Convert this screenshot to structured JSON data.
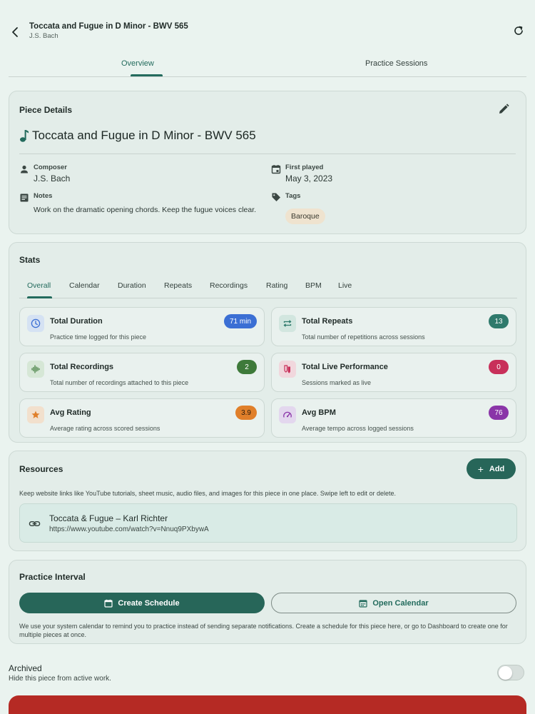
{
  "header": {
    "title": "Toccata and Fugue in D Minor - BWV 565",
    "subtitle": "J.S. Bach"
  },
  "tabs": [
    {
      "label": "Overview",
      "active": true
    },
    {
      "label": "Practice Sessions",
      "active": false
    }
  ],
  "piece_details": {
    "title": "Piece Details",
    "piece_name": "Toccata and Fugue in D Minor - BWV 565",
    "composer_label": "Composer",
    "composer": "J.S. Bach",
    "first_played_label": "First played",
    "first_played": "May 3, 2023",
    "notes_label": "Notes",
    "notes": "Work on the dramatic opening chords. Keep the fugue voices clear.",
    "tags_label": "Tags",
    "tags": [
      "Baroque"
    ]
  },
  "stats": {
    "title": "Stats",
    "tabs": [
      "Overall",
      "Calendar",
      "Duration",
      "Repeats",
      "Recordings",
      "Rating",
      "BPM",
      "Live"
    ],
    "active_tab": "Overall",
    "cards": [
      {
        "title": "Total Duration",
        "description": "Practice time logged for this piece",
        "badge": "71 min",
        "badge_color": "#3b6fd4",
        "icon": "clock-icon",
        "icon_bg": "#d5e2f3",
        "icon_color": "#3b6fd4"
      },
      {
        "title": "Total Repeats",
        "description": "Total number of repetitions across sessions",
        "badge": "13",
        "badge_color": "#2f7a6c",
        "icon": "repeat-icon",
        "icon_bg": "#d2e6df",
        "icon_color": "#2f7a6c"
      },
      {
        "title": "Total Recordings",
        "description": "Total number of recordings attached to this piece",
        "badge": "2",
        "badge_color": "#3e7a3a",
        "icon": "waveform-icon",
        "icon_bg": "#d6e7d6",
        "icon_color": "#3e7a3a"
      },
      {
        "title": "Total Live Performance",
        "description": "Sessions marked as live",
        "badge": "0",
        "badge_color": "#c8305a",
        "icon": "theater-icon",
        "icon_bg": "#f1d7dd",
        "icon_color": "#c8305a"
      },
      {
        "title": "Avg Rating",
        "description": "Average rating across scored sessions",
        "badge": "3.9",
        "badge_color": "#e07f2a",
        "icon": "star-icon",
        "icon_bg": "#f2e0cd",
        "icon_color": "#e07f2a"
      },
      {
        "title": "Avg BPM",
        "description": "Average tempo across logged sessions",
        "badge": "76",
        "badge_color": "#8a35a8",
        "icon": "speedometer-icon",
        "icon_bg": "#e3d7ee",
        "icon_color": "#8a35a8"
      }
    ]
  },
  "resources": {
    "title": "Resources",
    "add_label": "Add",
    "help": "Keep website links like YouTube tutorials, sheet music, audio files, and images for this piece in one place. Swipe left to edit or delete.",
    "items": [
      {
        "name": "Toccata & Fugue – Karl Richter",
        "url": "https://www.youtube.com/watch?v=Nnuq9PXbywA"
      }
    ]
  },
  "practice_interval": {
    "title": "Practice Interval",
    "create_label": "Create Schedule",
    "open_label": "Open Calendar",
    "help": "We use your system calendar to remind you to practice instead of sending separate notifications. Create a schedule for this piece here, or go to Dashboard to create one for multiple pieces at once."
  },
  "archived": {
    "label": "Archived",
    "description": "Hide this piece from active work.",
    "enabled": false
  },
  "colors": {
    "accent": "#236b5d",
    "button": "#276659",
    "danger": "#b52a24",
    "background": "#eaf3ef"
  }
}
